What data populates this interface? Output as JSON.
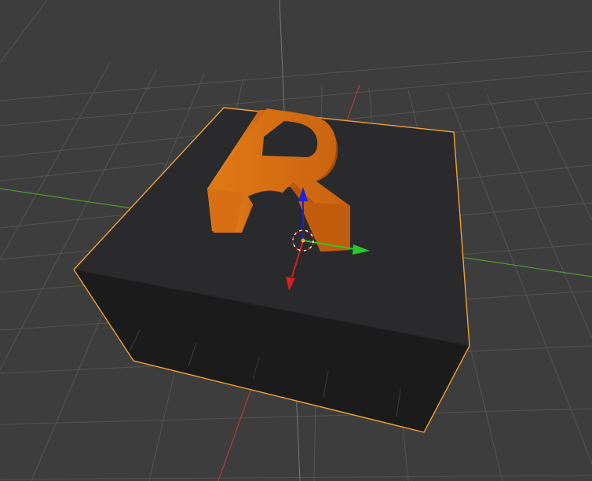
{
  "viewport": {
    "background_color": "#3d3d3d",
    "grid_color": "#5a5a5a",
    "x_axis_color": "#b33a3a",
    "y_axis_color": "#4f9a32",
    "z_axis_color": "#6e6e6e"
  },
  "scene": {
    "base_object": "box",
    "base_top_color": "#2a2a2b",
    "base_side_color": "#1a1a1b",
    "selection_outline_color": "#f0a030",
    "text_object": "R",
    "text_color": "#d67012"
  },
  "gizmo": {
    "x_arrow_color": "#d42020",
    "y_arrow_color": "#28c828",
    "z_arrow_color": "#2020d8",
    "cursor_icon": "3d-cursor-icon"
  }
}
